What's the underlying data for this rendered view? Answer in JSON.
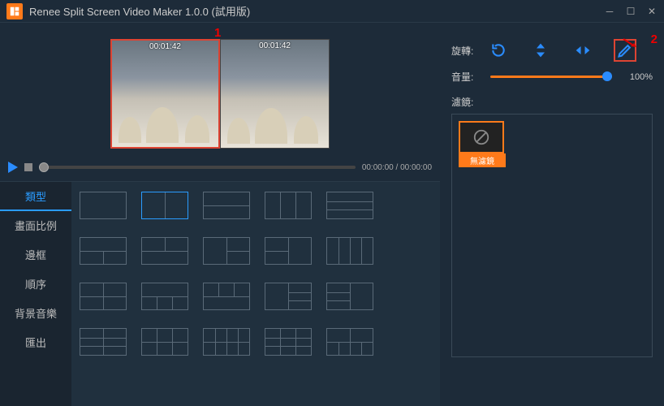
{
  "app": {
    "title": "Renee Split Screen Video Maker 1.0.0 (試用版)"
  },
  "callouts": {
    "one": "1",
    "two": "2"
  },
  "preview": {
    "clips": [
      {
        "timestamp": "00:01:42",
        "selected": true
      },
      {
        "timestamp": "00:01:42",
        "selected": false
      }
    ]
  },
  "playback": {
    "current_time": "00:00:00",
    "total_time": "00:00:00",
    "time_display": "00:00:00 / 00:00:00"
  },
  "sidebar": {
    "tabs": [
      {
        "label": "類型",
        "active": true
      },
      {
        "label": "畫面比例",
        "active": false
      },
      {
        "label": "邊框",
        "active": false
      },
      {
        "label": "順序",
        "active": false
      },
      {
        "label": "背景音樂",
        "active": false
      },
      {
        "label": "匯出",
        "active": false
      }
    ]
  },
  "transform": {
    "label": "旋轉:"
  },
  "volume": {
    "label": "音量:",
    "value": "100%"
  },
  "filters": {
    "label": "濾鏡:",
    "items": [
      {
        "name": "無濾鏡",
        "selected": true
      }
    ]
  }
}
